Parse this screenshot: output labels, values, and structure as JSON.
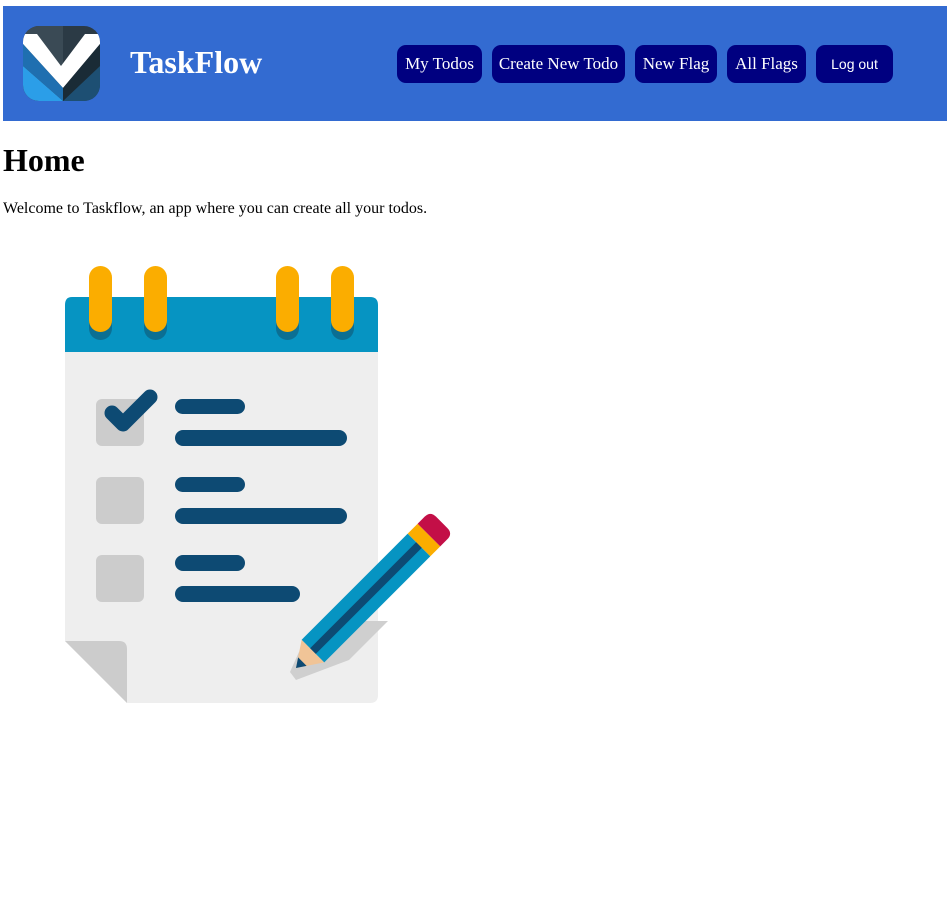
{
  "header": {
    "brand": "TaskFlow",
    "logo_icon": "taskflow-checkmark-logo",
    "nav": [
      {
        "label": "My Todos"
      },
      {
        "label": "Create New Todo"
      },
      {
        "label": "New Flag"
      },
      {
        "label": "All Flags"
      },
      {
        "label": "Log out"
      }
    ]
  },
  "main": {
    "title": "Home",
    "welcome": "Welcome to Taskflow, an app where you can create all your todos.",
    "illustration_icon": "todo-checklist-pencil-illustration"
  },
  "colors": {
    "navbar": "#336bd1",
    "nav_button": "#000080",
    "nav_text": "#ffffff"
  }
}
